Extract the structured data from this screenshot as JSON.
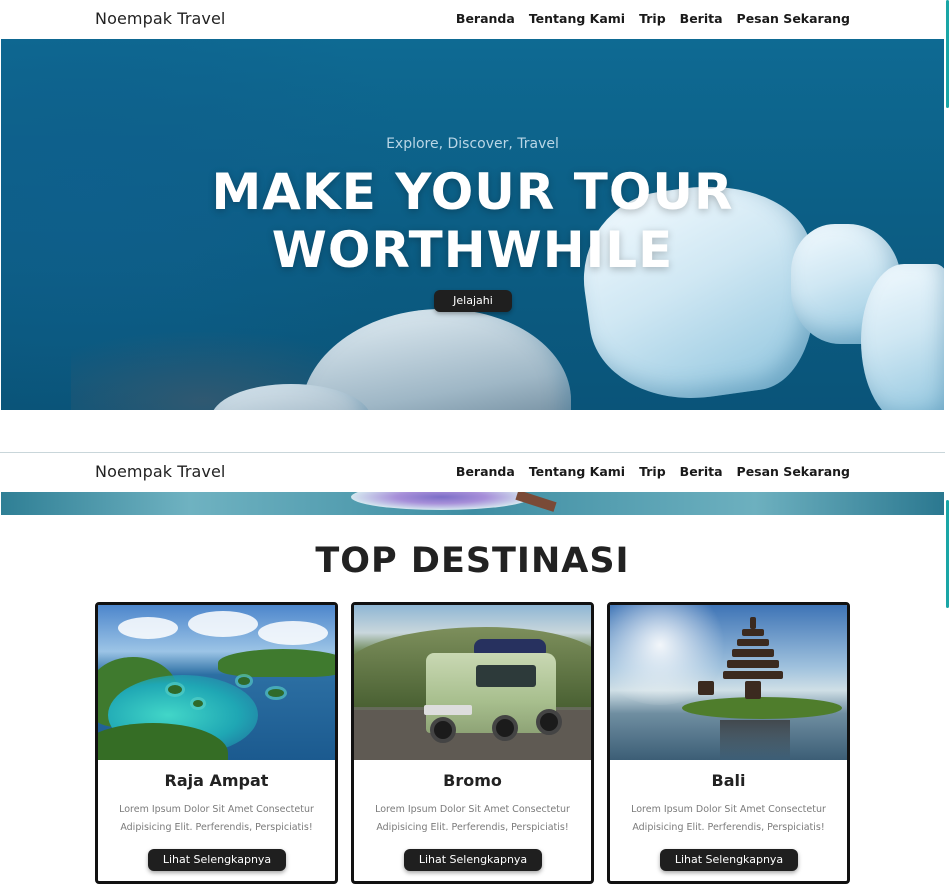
{
  "brand": "Noempak Travel",
  "nav": [
    "Beranda",
    "Tentang Kami",
    "Trip",
    "Berita",
    "Pesan Sekarang"
  ],
  "hero": {
    "tagline": "Explore, Discover, Travel",
    "headline_line1": "MAKE YOUR TOUR",
    "headline_line2": "WORTHWHILE",
    "cta": "Jelajahi"
  },
  "destinations": {
    "title": "TOP DESTINASI",
    "cards": [
      {
        "name": "Raja Ampat",
        "desc": "Lorem Ipsum Dolor Sit Amet Consectetur Adipisicing Elit. Perferendis, Perspiciatis!",
        "button": "Lihat Selengkapnya"
      },
      {
        "name": "Bromo",
        "desc": "Lorem Ipsum Dolor Sit Amet Consectetur Adipisicing Elit. Perferendis, Perspiciatis!",
        "button": "Lihat Selengkapnya"
      },
      {
        "name": "Bali",
        "desc": "Lorem Ipsum Dolor Sit Amet Consectetur Adipisicing Elit. Perferendis, Perspiciatis!",
        "button": "Lihat Selengkapnya"
      }
    ]
  },
  "colors": {
    "accent": "#1aa6a6",
    "button_bg": "#1f1f1f",
    "hero_blue": "#0c5f86"
  }
}
